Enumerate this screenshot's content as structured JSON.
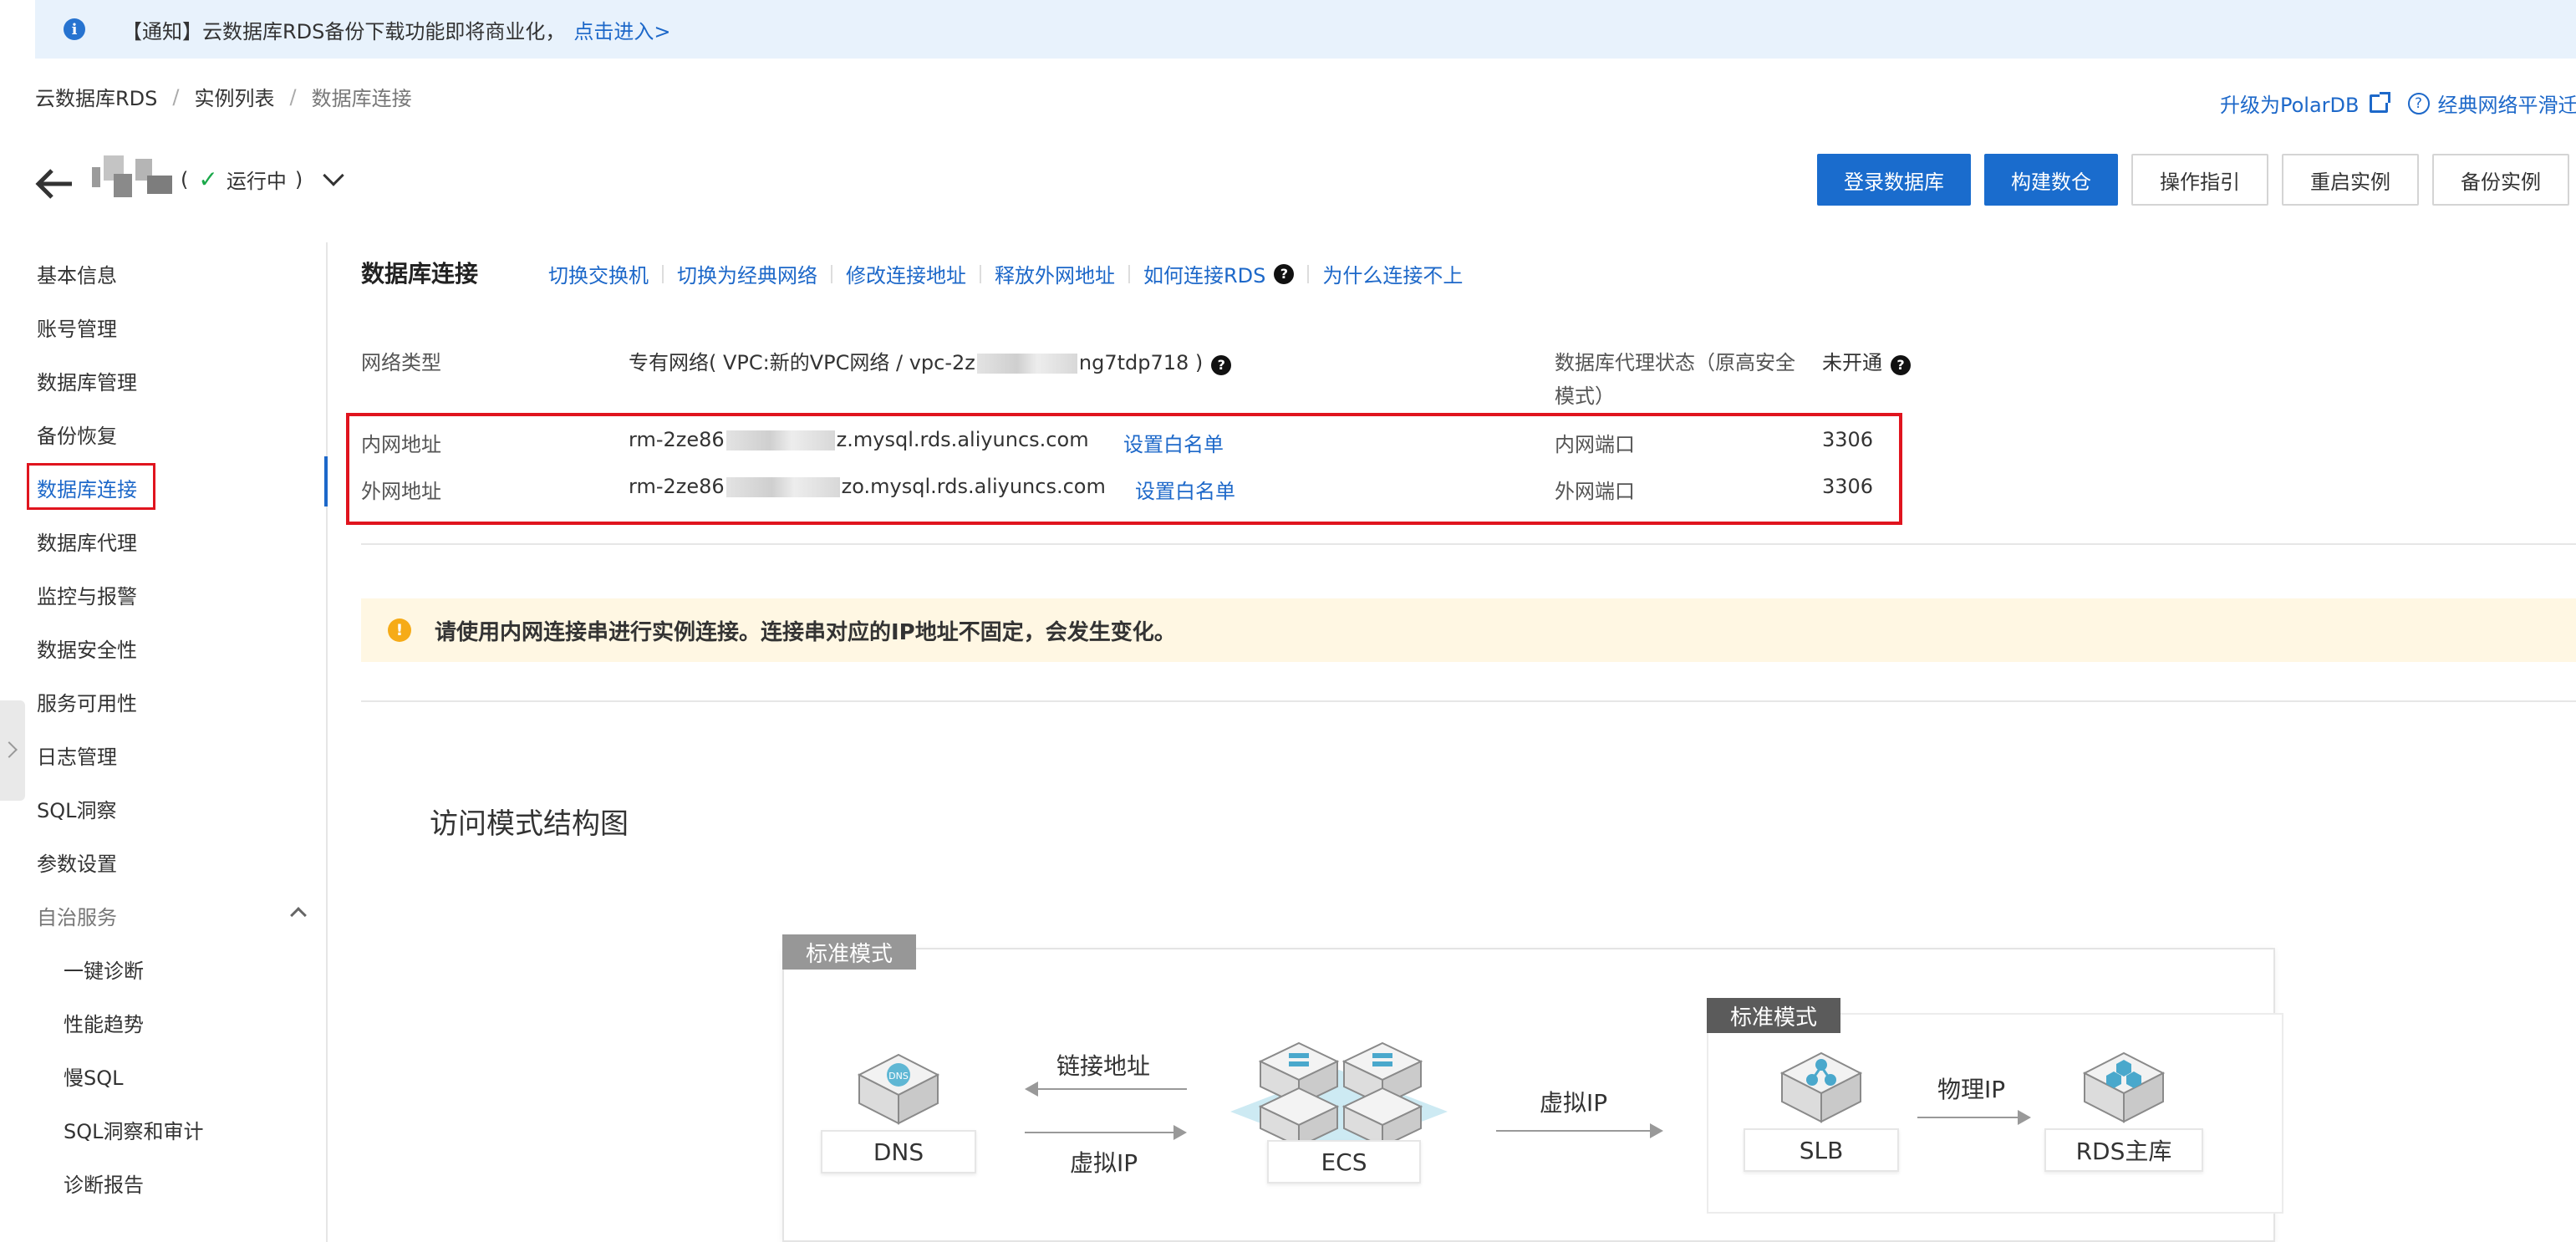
{
  "notice": {
    "text": "【通知】云数据库RDS备份下载功能即将商业化，",
    "link": "点击进入>"
  },
  "breadcrumb": {
    "items": [
      "云数据库RDS",
      "实例列表",
      "数据库连接"
    ]
  },
  "top_links": {
    "upgrade": "升级为PolarDB",
    "classic_migrate": "经典网络平滑迁移"
  },
  "instance": {
    "status_open": "(",
    "status": "运行中",
    "status_close": ")"
  },
  "header_buttons": [
    "登录数据库",
    "构建数仓",
    "操作指引",
    "重启实例",
    "备份实例"
  ],
  "sidebar": {
    "items": [
      "基本信息",
      "账号管理",
      "数据库管理",
      "备份恢复",
      "数据库连接",
      "数据库代理",
      "监控与报警",
      "数据安全性",
      "服务可用性",
      "日志管理",
      "SQL洞察",
      "参数设置"
    ],
    "group": "自治服务",
    "sub_items": [
      "一键诊断",
      "性能趋势",
      "慢SQL",
      "SQL洞察和审计",
      "诊断报告"
    ]
  },
  "connection": {
    "title": "数据库连接",
    "links": [
      "切换交换机",
      "切换为经典网络",
      "修改连接地址",
      "释放外网地址",
      "如何连接RDS",
      "为什么连接不上"
    ],
    "network_type_label": "网络类型",
    "network_type_prefix": "专有网络( VPC:新的VPC网络 / vpc-2z",
    "network_type_suffix": "ng7tdp718 )",
    "proxy_status_label_1": "数据库代理状态（原高安全",
    "proxy_status_label_2": "模式）",
    "proxy_status_value": "未开通",
    "intranet_label": "内网地址",
    "intranet_prefix": "rm-2ze86",
    "intranet_suffix": "z.mysql.rds.aliyuncs.com",
    "whitelist_1": "设置白名单",
    "intranet_port_label": "内网端口",
    "intranet_port": "3306",
    "internet_label": "外网地址",
    "internet_prefix": "rm-2ze86",
    "internet_suffix": "zo.mysql.rds.aliyuncs.com",
    "whitelist_2": "设置白名单",
    "internet_port_label": "外网端口",
    "internet_port": "3306"
  },
  "warning": {
    "text": "请使用内网连接串进行实例连接。连接串对应的IP地址不固定，会发生变化。"
  },
  "diagram": {
    "title": "访问模式结构图",
    "mode_outer": "标准模式",
    "mode_inner": "标准模式",
    "nodes": {
      "dns": "DNS",
      "ecs": "ECS",
      "slb": "SLB",
      "rds": "RDS主库"
    },
    "arrows": {
      "link_address": "链接地址",
      "virtual_ip_1": "虚拟IP",
      "virtual_ip_2": "虚拟IP",
      "physical_ip": "物理IP"
    },
    "dns_badge": "DNS"
  }
}
